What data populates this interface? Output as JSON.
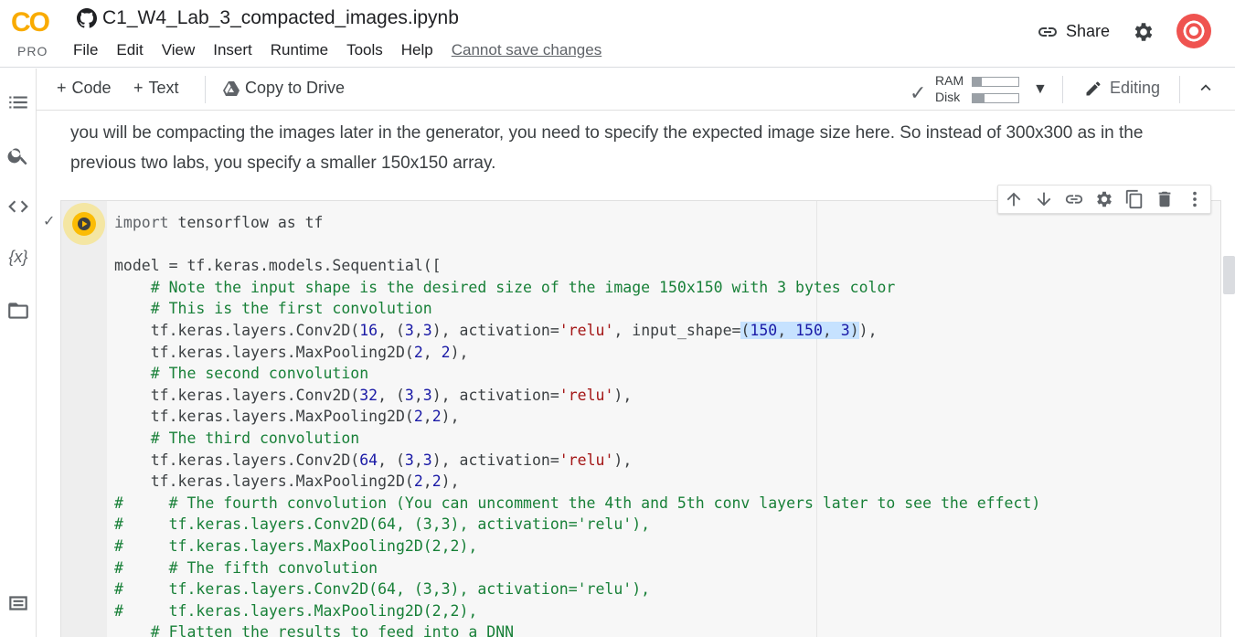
{
  "header": {
    "logo_text": "CO",
    "plan": "PRO",
    "title": "C1_W4_Lab_3_compacted_images.ipynb",
    "menu": [
      "File",
      "Edit",
      "View",
      "Insert",
      "Runtime",
      "Tools",
      "Help"
    ],
    "save_status": "Cannot save changes",
    "share_label": "Share"
  },
  "toolbar": {
    "code_label": "Code",
    "text_label": "Text",
    "copy_label": "Copy to Drive",
    "ram_label": "RAM",
    "disk_label": "Disk",
    "ram_fraction": 0.2,
    "disk_fraction": 0.25,
    "editing_label": "Editing"
  },
  "markdown": {
    "line1": "you will be compacting the images later in the generator, you need to specify the expected image size here. So instead of 300x300 as in the",
    "line2": "previous two labs, you specify a smaller 150x150 array."
  },
  "code": {
    "lines": [
      "import tensorflow as tf",
      "",
      "model = tf.keras.models.Sequential([",
      "    # Note the input shape is the desired size of the image 150x150 with 3 bytes color",
      "    # This is the first convolution",
      "    tf.keras.layers.Conv2D(16, (3,3), activation='relu', input_shape=(150, 150, 3)),",
      "    tf.keras.layers.MaxPooling2D(2, 2),",
      "    # The second convolution",
      "    tf.keras.layers.Conv2D(32, (3,3), activation='relu'),",
      "    tf.keras.layers.MaxPooling2D(2,2),",
      "    # The third convolution",
      "    tf.keras.layers.Conv2D(64, (3,3), activation='relu'),",
      "    tf.keras.layers.MaxPooling2D(2,2),",
      "#     # The fourth convolution (You can uncomment the 4th and 5th conv layers later to see the effect)",
      "#     tf.keras.layers.Conv2D(64, (3,3), activation='relu'),",
      "#     tf.keras.layers.MaxPooling2D(2,2),",
      "#     # The fifth convolution",
      "#     tf.keras.layers.Conv2D(64, (3,3), activation='relu'),",
      "#     tf.keras.layers.MaxPooling2D(2,2),",
      "    # Flatten the results to feed into a DNN"
    ]
  },
  "colors": {
    "comment": "#188038",
    "string": "#a31515",
    "number": "#1a1aa6",
    "highlight": "#c6e2ff",
    "run_button": "#fbbc04"
  },
  "icons": {
    "left": [
      "table-of-contents-icon",
      "search-icon",
      "code-snippets-icon",
      "variables-icon",
      "files-icon",
      "terminal-icon"
    ],
    "cell_toolbar": [
      "move-up-icon",
      "move-down-icon",
      "link-icon",
      "settings-icon",
      "mirror-cell-icon",
      "delete-icon",
      "more-icon"
    ]
  }
}
